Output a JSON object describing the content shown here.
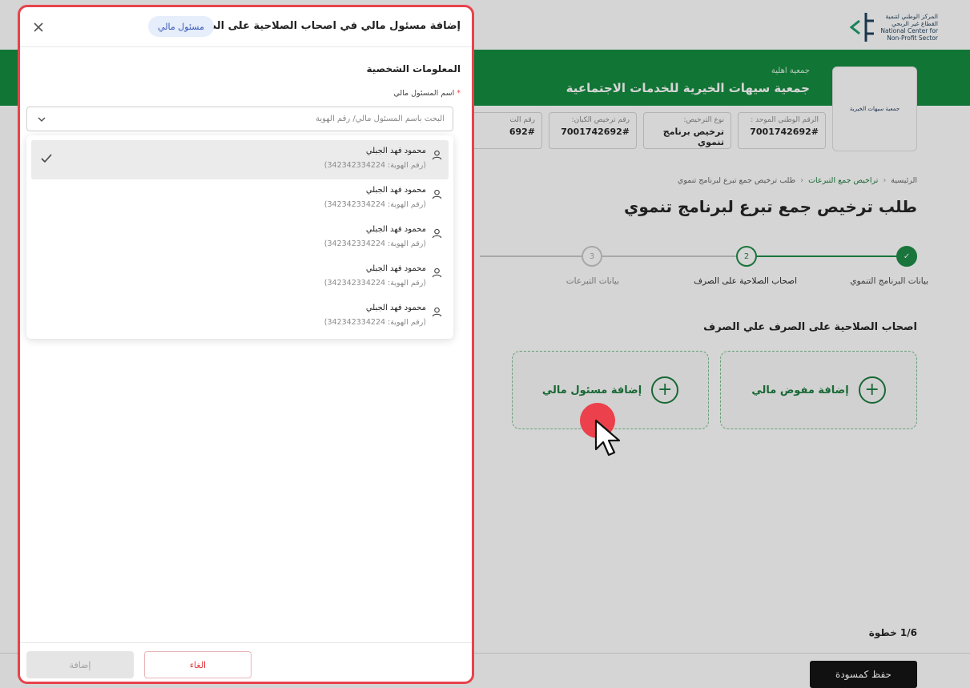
{
  "background": {
    "logo_lines": [
      "المركز الوطني لتنمية",
      "القطاع غير الربحي",
      "National Center for",
      "Non-Profit Sector"
    ],
    "org_type": "جمعية اهلية",
    "org_name": "جمعية سيهات الخيرية للخدمات الاجتماعية",
    "org_card_logo": "جمعية سيهات الخيرية",
    "info_boxes": [
      {
        "label": "الرقم الوطني الموحد :",
        "value": "7001742692#"
      },
      {
        "label": "نوع الترخيص:",
        "value": "ترخيص برنامج تنموي"
      },
      {
        "label": "رقم ترخيص الكيان:",
        "value": "7001742692#"
      },
      {
        "label": "رقم الت",
        "value": "692#"
      }
    ],
    "breadcrumb": [
      "الرئيسية",
      "تراخيص جمع التبرعات",
      "طلب ترخيص جمع تبرع لبرنامج تنموي"
    ],
    "page_title": "طلب ترخيص جمع تبرع لبرنامج تنموي",
    "steps": [
      {
        "num": "✓",
        "label": "بيانات البرنامج التنموي",
        "state": "done"
      },
      {
        "num": "2",
        "label": "اصحاب الصلاحية على الصرف",
        "state": "current"
      },
      {
        "num": "3",
        "label": "بيانات التبرعات",
        "state": "pending"
      }
    ],
    "section_title": "اصحاب الصلاحية على الصرف علي الصرف",
    "card_authorized": "إضافة مفوض مالي",
    "card_financial": "إضافة مسئول مالي",
    "step_count": "1/6 خطوة",
    "save_draft": "حفظ كمسودة"
  },
  "drawer": {
    "title": "إضافة مسئول مالي في اصحاب الصلاحية على الصرف",
    "badge": "مسئول مالي",
    "section_head": "المعلومات الشخصية",
    "field_label": "اسم المسئول مالي",
    "required_mark": "*",
    "search_placeholder": "البحث باسم المسئول مالي/ رقم الهوية",
    "options": [
      {
        "name": "محمود فهد الجبلي",
        "id": "(رقم الهوية: 342342334224)",
        "selected": true
      },
      {
        "name": "محمود فهد الجبلي",
        "id": "(رقم الهوية: 342342334224)",
        "selected": false
      },
      {
        "name": "محمود فهد الجبلي",
        "id": "(رقم الهوية: 342342334224)",
        "selected": false
      },
      {
        "name": "محمود فهد الجبلي",
        "id": "(رقم الهوية: 342342334224)",
        "selected": false
      },
      {
        "name": "محمود فهد الجبلي",
        "id": "(رقم الهوية: 342342334224)",
        "selected": false
      }
    ],
    "cancel_label": "الغاء",
    "add_label": "إضافة"
  },
  "colors": {
    "brand_green": "#108a3c",
    "highlight_red": "#e8434b",
    "badge_blue": "#3557b8"
  }
}
